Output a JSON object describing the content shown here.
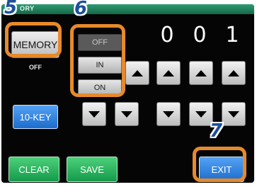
{
  "title_bar": {
    "text": "ORY"
  },
  "memory_button": {
    "label": "MEMORY"
  },
  "memory_status": {
    "label": "OFF"
  },
  "memory_options": [
    {
      "label": "OFF",
      "selected": true
    },
    {
      "label": "IN",
      "selected": false
    },
    {
      "label": "ON",
      "selected": false
    }
  ],
  "digits": [
    "0",
    "0",
    "1"
  ],
  "up_arrow_icon": "triangle-up",
  "down_arrow_icon": "triangle-down",
  "tenkey_button": {
    "label": "10-KEY"
  },
  "clear_button": {
    "label": "CLEAR"
  },
  "save_button": {
    "label": "SAVE"
  },
  "exit_button": {
    "label": "EXIT"
  },
  "callouts": {
    "memory": "5",
    "options": "6",
    "exit": "7"
  },
  "colors": {
    "highlight": "#e68a2b",
    "callout_text": "#1d4f9a",
    "screen_bg": "#050505",
    "title_bar": "#15684a",
    "green_button": "#159a4b",
    "blue_button": "#1c6dcc"
  }
}
